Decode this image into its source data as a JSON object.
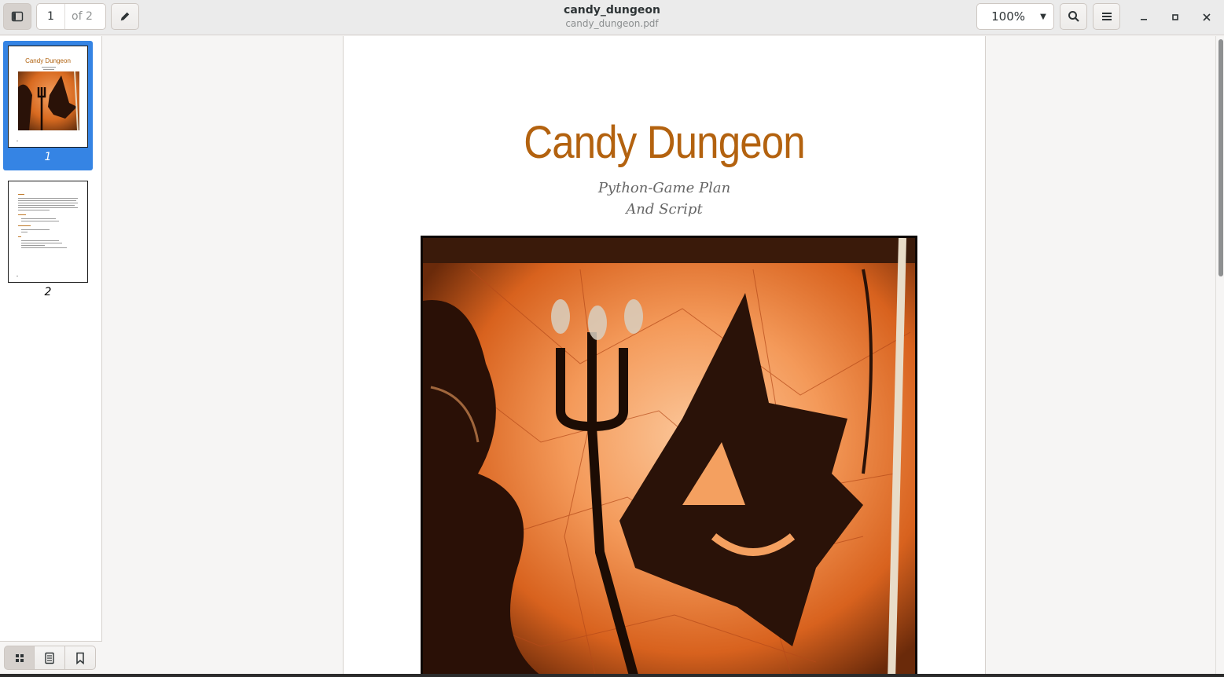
{
  "header": {
    "title": "candy_dungeon",
    "subtitle": "candy_dungeon.pdf",
    "page_current": "1",
    "page_total": "of 2",
    "zoom": "100%"
  },
  "sidebar": {
    "thumbnails": [
      {
        "label": "1",
        "selected": true,
        "title": "Candy Dungeon"
      },
      {
        "label": "2",
        "selected": false
      }
    ]
  },
  "document": {
    "title": "Candy Dungeon",
    "subtitle_line1": "Python-Game Plan",
    "subtitle_line2": "And Script"
  },
  "colors": {
    "accent": "#3584e4",
    "title_orange": "#b3620f"
  }
}
